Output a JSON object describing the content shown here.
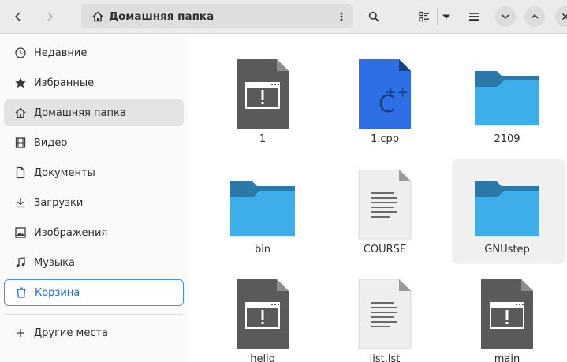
{
  "header": {
    "back_label": "back",
    "path_label": "Домашняя папка",
    "colors": {
      "bar": "#ebebeb",
      "pathbar": "#dedede"
    }
  },
  "sidebar": {
    "items": [
      {
        "label": "Недавние",
        "icon": "clock-icon"
      },
      {
        "label": "Избранные",
        "icon": "star-icon"
      },
      {
        "label": "Домашняя папка",
        "icon": "home-icon",
        "active": true
      },
      {
        "label": "Видео",
        "icon": "film-icon"
      },
      {
        "label": "Документы",
        "icon": "document-icon"
      },
      {
        "label": "Загрузки",
        "icon": "download-icon"
      },
      {
        "label": "Изображения",
        "icon": "image-icon"
      },
      {
        "label": "Музыка",
        "icon": "music-icon"
      },
      {
        "label": "Корзина",
        "icon": "trash-icon",
        "drop_target": true
      }
    ],
    "other": {
      "label": "Другие места",
      "icon": "plus-icon"
    }
  },
  "files": [
    {
      "name": "1",
      "type": "executable"
    },
    {
      "name": "1.cpp",
      "type": "cpp-source"
    },
    {
      "name": "2109",
      "type": "folder"
    },
    {
      "name": "bin",
      "type": "folder"
    },
    {
      "name": "COURSE",
      "type": "text"
    },
    {
      "name": "GNUstep",
      "type": "folder",
      "hovered": true
    },
    {
      "name": "hello",
      "type": "executable"
    },
    {
      "name": "list.lst",
      "type": "text"
    },
    {
      "name": "main",
      "type": "executable"
    }
  ],
  "colors": {
    "folder_back": "#2b79a8",
    "folder_front": "#3daee9",
    "exec": "#5a5a5a",
    "cpp": "#2f6fe6",
    "accent": "#4a90d9"
  }
}
